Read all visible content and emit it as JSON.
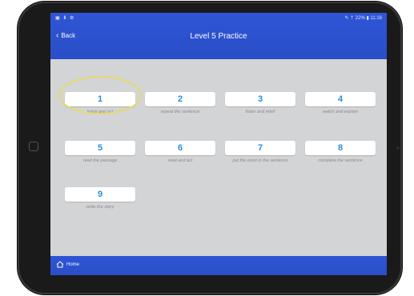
{
  "status_bar": {
    "left": "▣ ⬇ ⚙",
    "right": "✎ ⇡ 22% ▮ 11:16"
  },
  "header": {
    "back_label": "Back",
    "title": "Level 5 Practice"
  },
  "exercises": [
    {
      "number": "1",
      "label": "listen and act"
    },
    {
      "number": "2",
      "label": "repeat the sentence"
    },
    {
      "number": "3",
      "label": "listen and retell"
    },
    {
      "number": "4",
      "label": "watch and explain"
    },
    {
      "number": "5",
      "label": "read the passage"
    },
    {
      "number": "6",
      "label": "read and act"
    },
    {
      "number": "7",
      "label": "put the word in the sentence"
    },
    {
      "number": "8",
      "label": "complete the sentence"
    },
    {
      "number": "9",
      "label": "write the story"
    }
  ],
  "footer": {
    "home_label": "Home"
  },
  "colors": {
    "accent_blue": "#2a4ec7",
    "number_blue": "#2a8ed6",
    "highlight": "#e8d96a"
  }
}
